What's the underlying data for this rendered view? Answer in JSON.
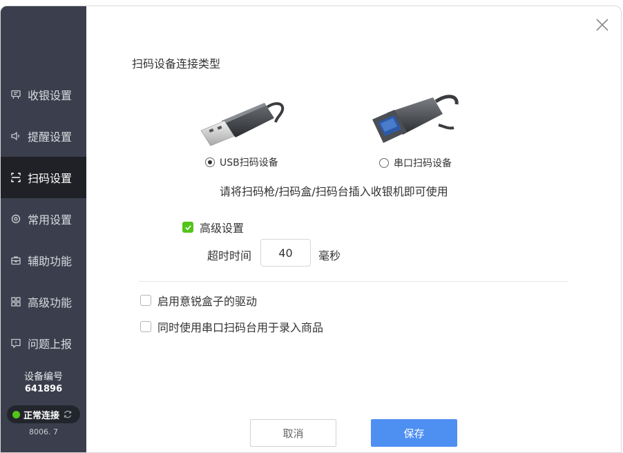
{
  "sidebar": {
    "items": [
      {
        "label": "收银设置",
        "icon": "cashier-icon",
        "active": false
      },
      {
        "label": "提醒设置",
        "icon": "speaker-icon",
        "active": false
      },
      {
        "label": "扫码设置",
        "icon": "scan-icon",
        "active": true
      },
      {
        "label": "常用设置",
        "icon": "gear-icon",
        "active": false
      },
      {
        "label": "辅助功能",
        "icon": "toolbox-icon",
        "active": false
      },
      {
        "label": "高级功能",
        "icon": "grid-icon",
        "active": false
      },
      {
        "label": "问题上报",
        "icon": "report-icon",
        "active": false
      }
    ],
    "device_label": "设备编号",
    "device_id": "641896",
    "connection_status": "正常连接",
    "version": "8006. 7"
  },
  "main": {
    "section_title": "扫码设备连接类型",
    "options": {
      "usb_label": "USB扫码设备",
      "serial_label": "串口扫码设备",
      "selected": "usb"
    },
    "hint": "请将扫码枪/扫码盒/扫码台插入收银机即可使用",
    "advanced": {
      "label": "高级设置",
      "checked": true,
      "timeout_label": "超时时间",
      "timeout_value": "40",
      "timeout_unit": "毫秒"
    },
    "enable_driver_label": "启用意锐盒子的驱动",
    "serial_record_label": "同时使用串口扫码台用于录入商品",
    "cancel_label": "取消",
    "save_label": "保存"
  },
  "colors": {
    "sidebar_bg": "#3b3f4d",
    "sidebar_active": "#1f2126",
    "accent": "#4e8ff2",
    "success": "#52c41a"
  }
}
